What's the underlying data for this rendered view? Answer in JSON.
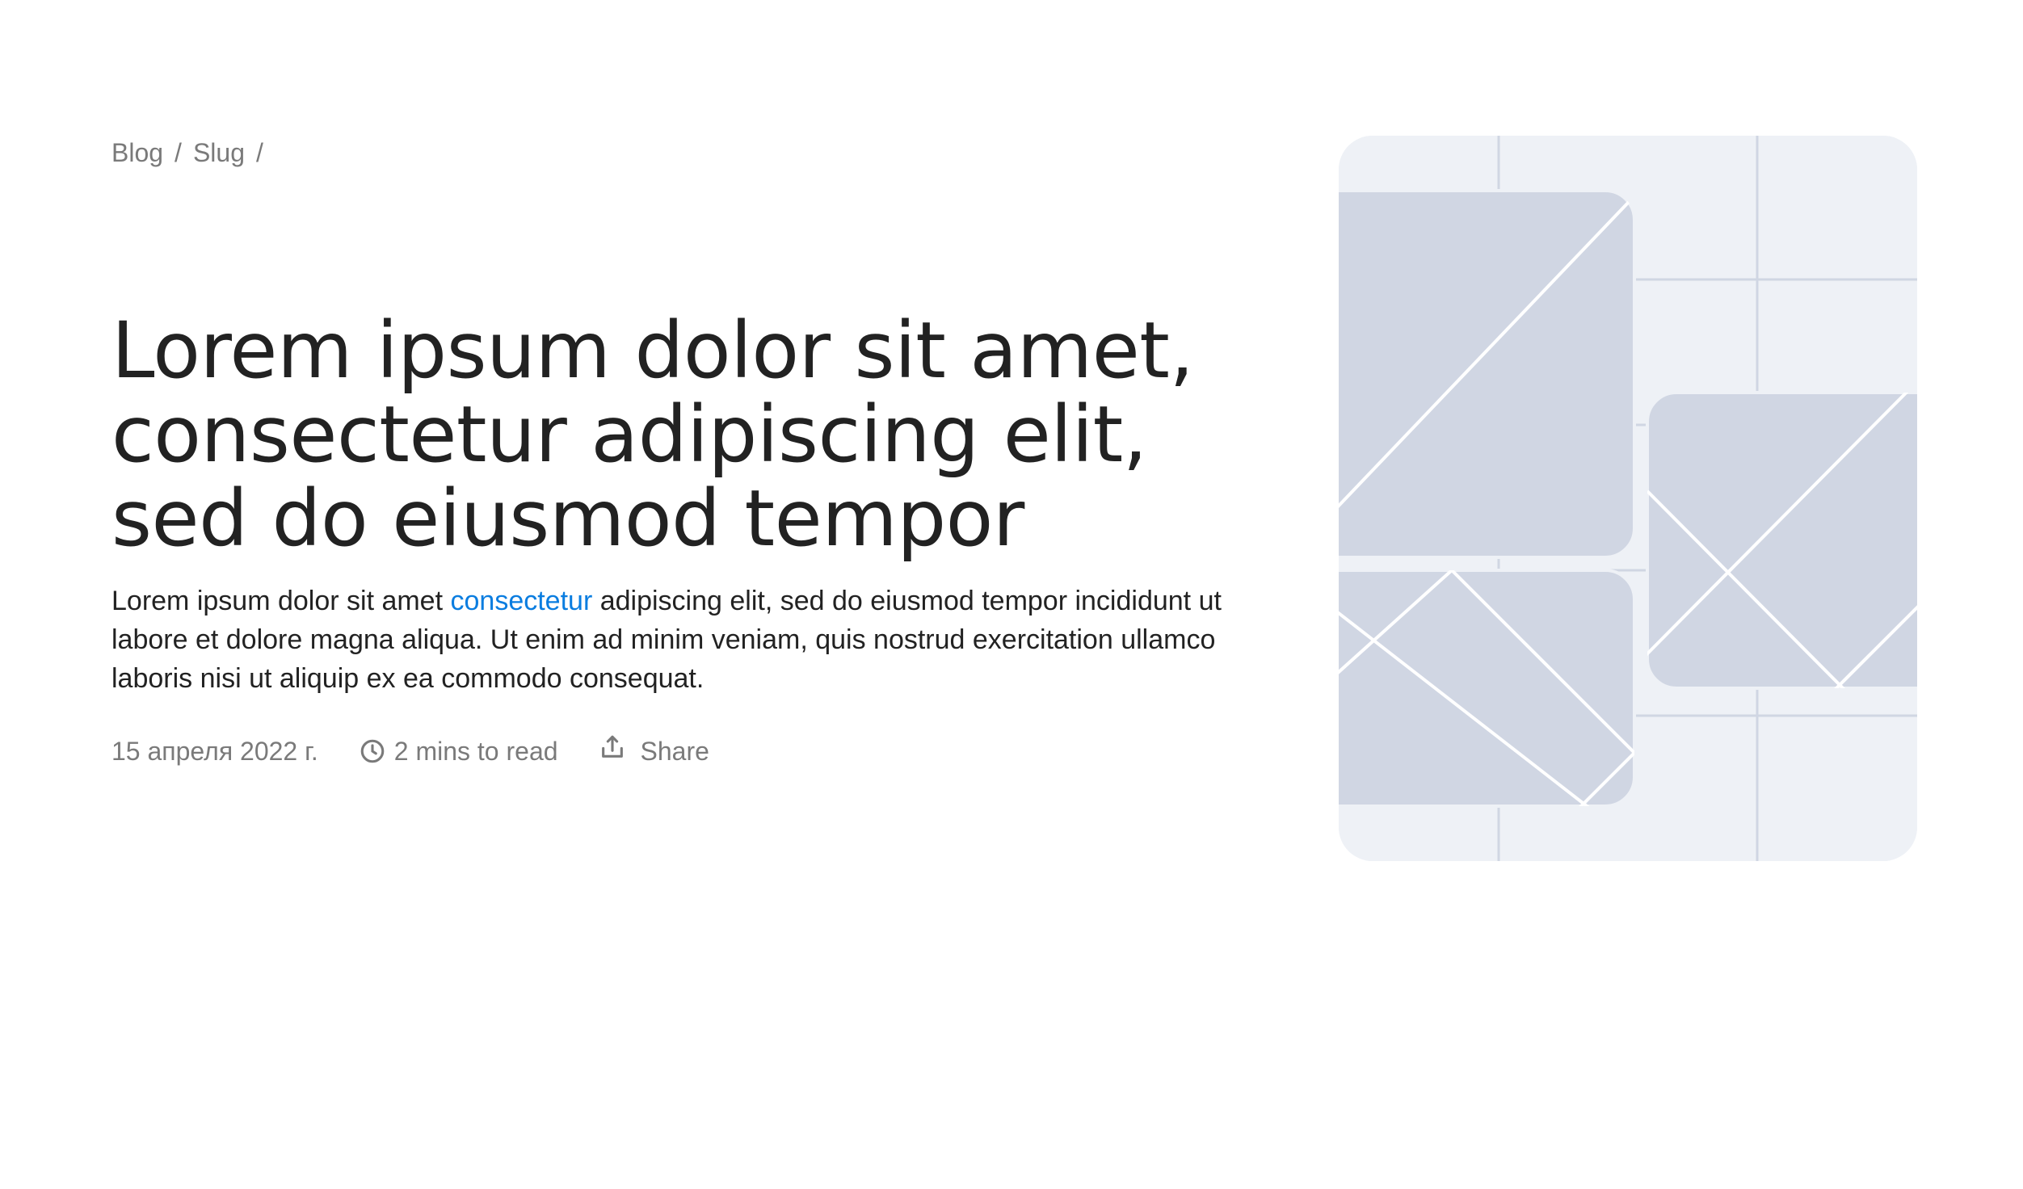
{
  "breadcrumb": {
    "items": [
      "Blog",
      "Slug"
    ],
    "separator": "/"
  },
  "article": {
    "title_lines": [
      "Lorem ipsum dolor sit amet,",
      "consectetur adipiscing elit,",
      "sed do eiusmod tempor"
    ],
    "lead": {
      "line1_before": "Lorem ipsum dolor sit amet ",
      "line1_link": "consectetur",
      "line1_after": " adipiscing elit, sed do eiusmod tempor incididunt ut",
      "line2": "labore et dolore magna aliqua. Ut enim ad minim veniam, quis nostrud exercitation ullamco",
      "line3": "laboris nisi ut aliquip ex ea commodo consequat."
    },
    "meta": {
      "date": "15 апреля 2022 г.",
      "read_time": "2 mins to read",
      "share_label": "Share",
      "read_icon": "clock-icon",
      "share_icon": "share-icon"
    }
  },
  "hero_image": {
    "icon": "placeholder-image",
    "colors": {
      "background": "#eef1f6",
      "tiles": "#d0d6e3",
      "lines": "#ffffff",
      "grid": "#d0d6e3"
    }
  },
  "colors": {
    "text": "#222222",
    "muted": "#7a7a7a",
    "link": "#0a7de0"
  }
}
